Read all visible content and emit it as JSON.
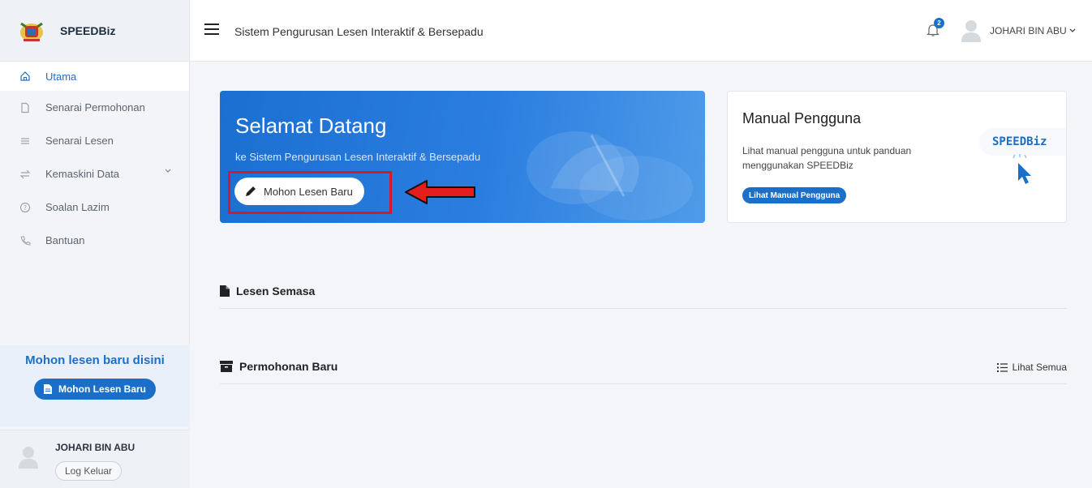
{
  "brand": {
    "name": "SPEEDBiz"
  },
  "sidebar": {
    "items": [
      {
        "label": "Utama",
        "icon": "home-icon"
      },
      {
        "label": "Senarai Permohonan",
        "icon": "file-icon"
      },
      {
        "label": "Senarai Lesen",
        "icon": "list-icon"
      },
      {
        "label": "Kemaskini Data",
        "icon": "sync-icon"
      },
      {
        "label": "Soalan Lazim",
        "icon": "question-icon"
      },
      {
        "label": "Bantuan",
        "icon": "phone-icon"
      }
    ],
    "promo_title": "Mohon lesen baru disini",
    "promo_button": "Mohon Lesen Baru",
    "user_name": "JOHARI BIN ABU",
    "logout_label": "Log Keluar"
  },
  "header": {
    "title": "Sistem Pengurusan Lesen Interaktif & Bersepadu",
    "notification_count": "2",
    "user_name": "JOHARI BIN ABU"
  },
  "welcome": {
    "title": "Selamat Datang",
    "subtitle": "ke Sistem Pengurusan Lesen Interaktif & Bersepadu",
    "button": "Mohon Lesen Baru"
  },
  "manual": {
    "title": "Manual Pengguna",
    "description": "Lihat manual pengguna untuk panduan menggunakan SPEEDBiz",
    "button": "Lihat Manual Pengguna",
    "logo_text": "SPEEDBiz"
  },
  "sections": {
    "current_license": "Lesen Semasa",
    "new_applications": "Permohonan Baru",
    "see_all": "Lihat Semua"
  },
  "colors": {
    "accent": "#1b6fc9",
    "highlight": "#d3192a"
  }
}
